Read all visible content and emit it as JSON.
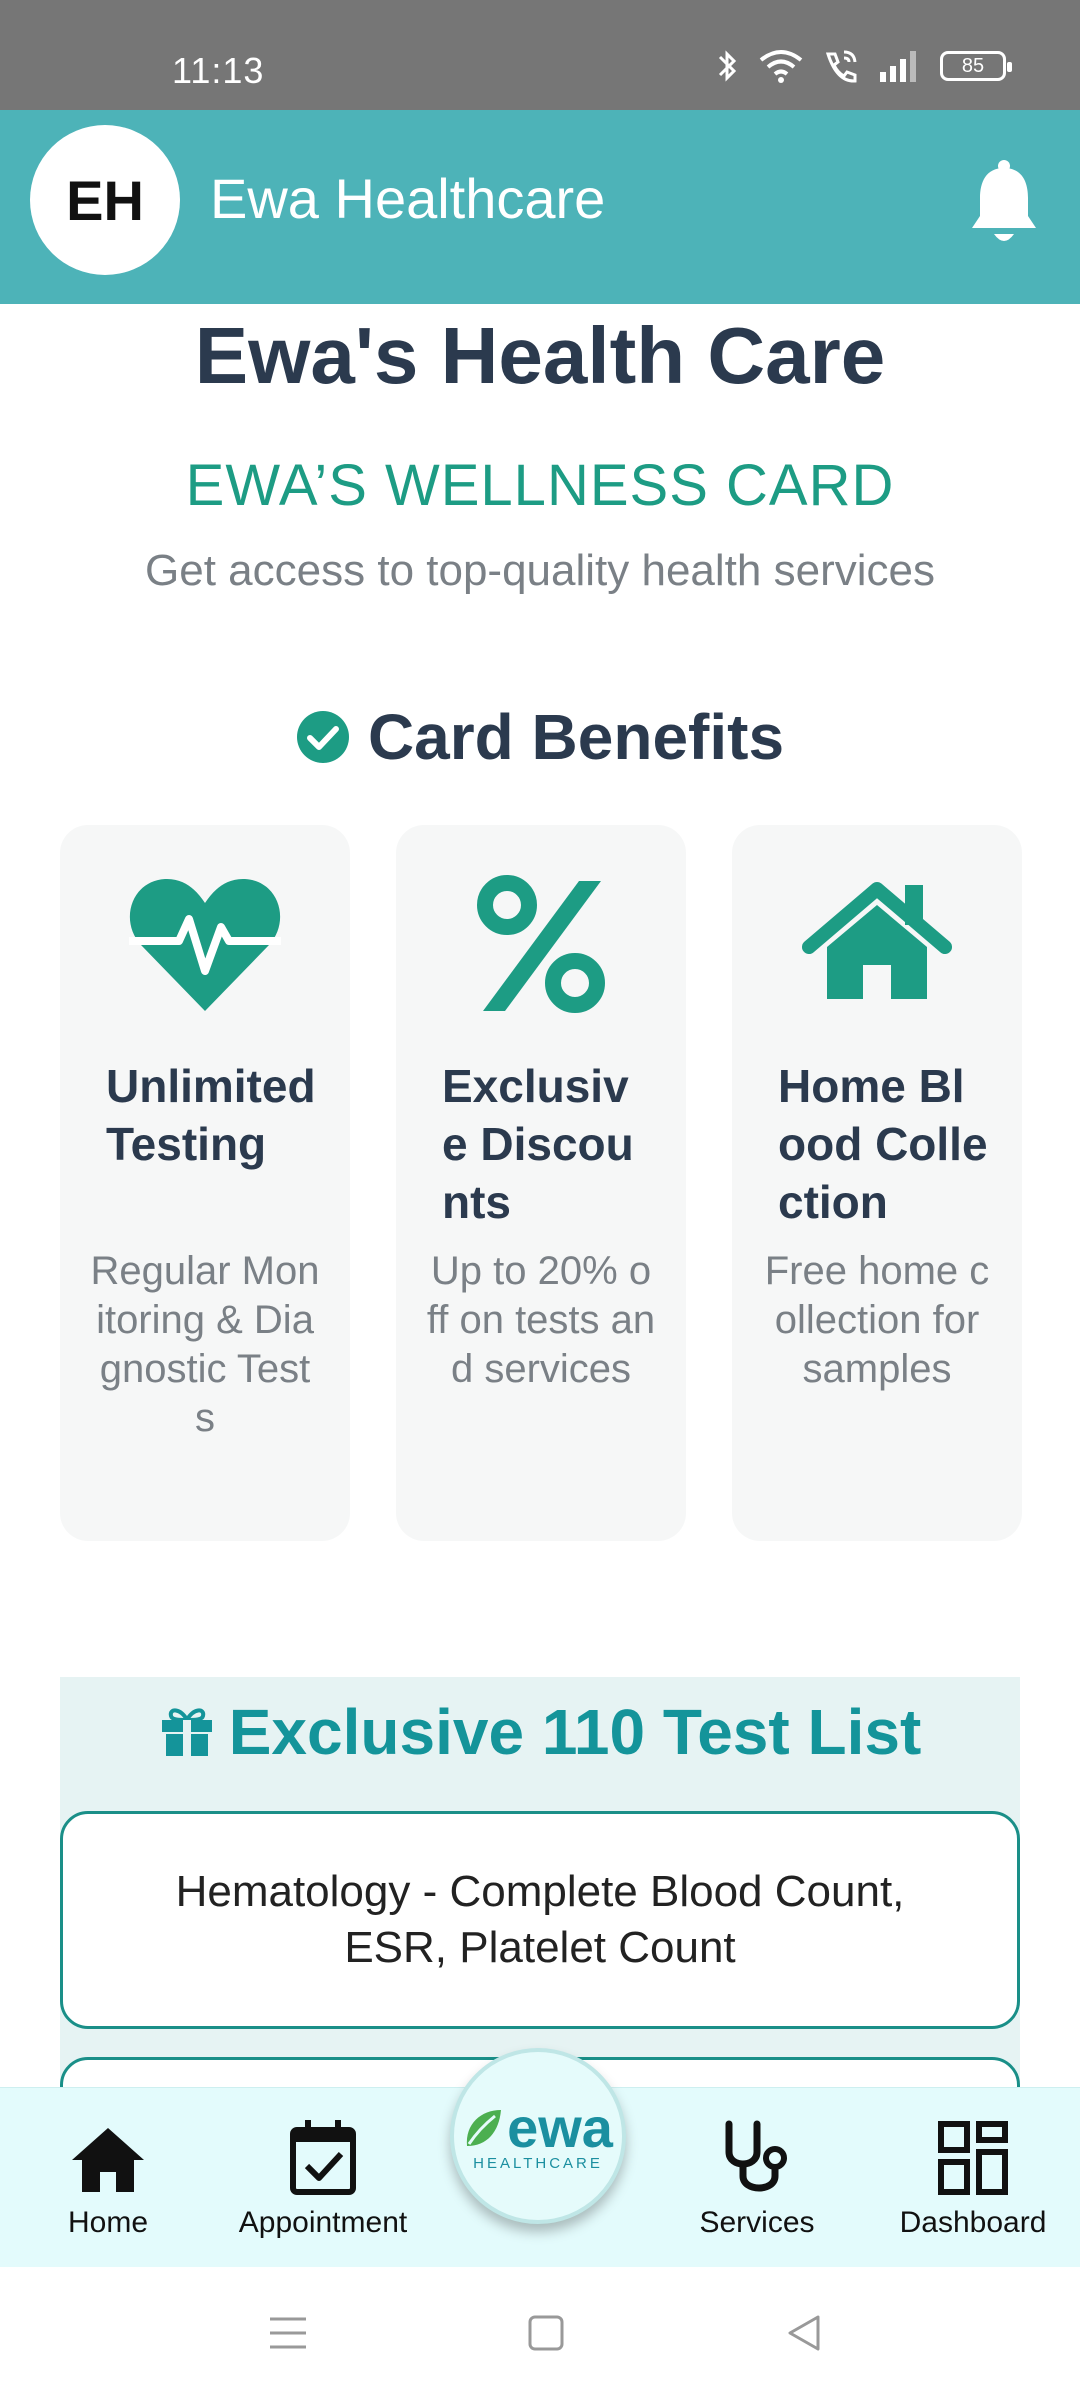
{
  "status_bar": {
    "time": "11:13",
    "battery": "85"
  },
  "app_bar": {
    "avatar_initials": "EH",
    "title": "Ewa Healthcare"
  },
  "header": {
    "title": "Ewa's Health Care",
    "card_name": "EWA’S WELLNESS CARD",
    "tagline": "Get access to top-quality health services"
  },
  "benefits": {
    "heading": "Card Benefits",
    "items": [
      {
        "icon": "heartbeat-icon",
        "title": "Unlimited Testing",
        "description": "Regular Monitoring & Diagnostic Tests"
      },
      {
        "icon": "percent-icon",
        "title": "Exclusive Discounts",
        "description": "Up to 20% off on tests and services"
      },
      {
        "icon": "home-icon",
        "title": "Home Blood Collection",
        "description": "Free home collection for samples"
      }
    ]
  },
  "test_list": {
    "heading": "Exclusive 110 Test List",
    "items": [
      "Hematology - Complete Blood Count, ESR, Platelet Count"
    ]
  },
  "bottom_nav": {
    "items": [
      "Home",
      "Appointment",
      "Services",
      "Dashboard"
    ],
    "logo_text": "ewa",
    "logo_subtext": "HEALTHCARE"
  },
  "colors": {
    "app_bar": "#4db3b8",
    "accent_green": "#1d9c84",
    "heading_teal": "#14949a",
    "nav_background": "#e3fbfc"
  }
}
